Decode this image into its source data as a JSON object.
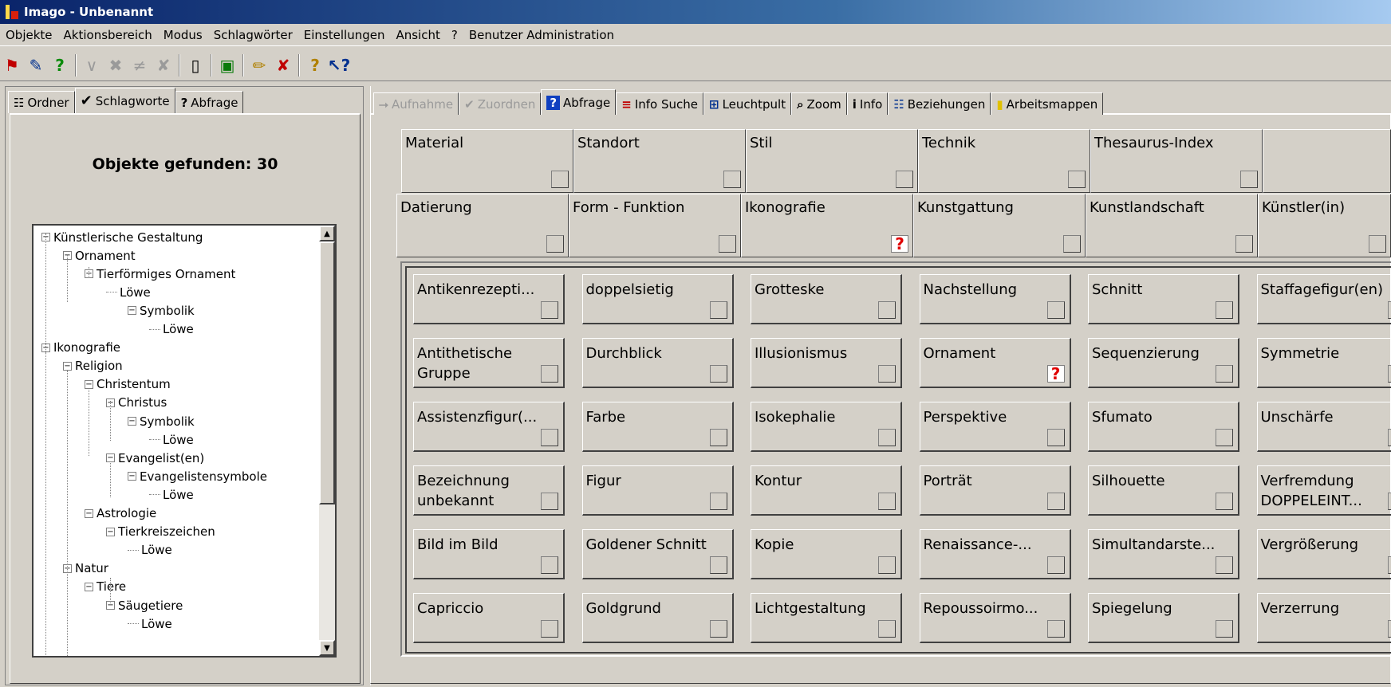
{
  "window": {
    "title": "Imago - Unbenannt"
  },
  "menu": [
    "Objekte",
    "Aktionsbereich",
    "Modus",
    "Schlagwörter",
    "Einstellungen",
    "Ansicht",
    "?",
    "Benutzer Administration"
  ],
  "toolbar": [
    "folders-icon",
    "edit-icon",
    "help-icon",
    "disabled-icon",
    "disabled-icon",
    "disabled-icon",
    "disabled-icon",
    "document-icon",
    "green-book-icon",
    "pencil-icon",
    "red-cross-icon",
    "help-icon",
    "what-is-icon"
  ],
  "left": {
    "tabs": [
      "Ordner",
      "Schlagworte",
      "Abfrage"
    ],
    "found_label": "Objekte gefunden: 30",
    "tree": [
      {
        "label": "Künstlerische Gestaltung",
        "lvl": 0,
        "exp": true
      },
      {
        "label": "Ornament",
        "lvl": 1,
        "exp": true
      },
      {
        "label": "Tierförmiges Ornament",
        "lvl": 2,
        "exp": true
      },
      {
        "label": "Löwe",
        "lvl": 3,
        "exp": false
      },
      {
        "label": "Symbolik",
        "lvl": 4,
        "exp": true
      },
      {
        "label": "Löwe",
        "lvl": 5,
        "exp": false
      },
      {
        "label": "Ikonografie",
        "lvl": 0,
        "exp": true
      },
      {
        "label": "Religion",
        "lvl": 1,
        "exp": true
      },
      {
        "label": "Christentum",
        "lvl": 2,
        "exp": true
      },
      {
        "label": "Christus",
        "lvl": 3,
        "exp": true
      },
      {
        "label": "Symbolik",
        "lvl": 4,
        "exp": true
      },
      {
        "label": "Löwe",
        "lvl": 5,
        "exp": false
      },
      {
        "label": "Evangelist(en)",
        "lvl": 3,
        "exp": true
      },
      {
        "label": "Evangelistensymbole",
        "lvl": 4,
        "exp": true
      },
      {
        "label": "Löwe",
        "lvl": 5,
        "exp": false
      },
      {
        "label": "Astrologie",
        "lvl": 2,
        "exp": true
      },
      {
        "label": "Tierkreiszeichen",
        "lvl": 3,
        "exp": true
      },
      {
        "label": "Löwe",
        "lvl": 4,
        "exp": false
      },
      {
        "label": "Natur",
        "lvl": 1,
        "exp": true
      },
      {
        "label": "Tiere",
        "lvl": 2,
        "exp": true
      },
      {
        "label": "Säugetiere",
        "lvl": 3,
        "exp": true
      },
      {
        "label": "Löwe",
        "lvl": 4,
        "exp": false
      }
    ]
  },
  "right": {
    "tabs": [
      {
        "label": "Aufnahme",
        "state": "disabled"
      },
      {
        "label": "Zuordnen",
        "state": "disabled"
      },
      {
        "label": "Abfrage",
        "state": "active"
      },
      {
        "label": "Info Suche",
        "state": "normal"
      },
      {
        "label": "Leuchtpult",
        "state": "normal"
      },
      {
        "label": "Zoom",
        "state": "normal"
      },
      {
        "label": "Info",
        "state": "normal"
      },
      {
        "label": "Beziehungen",
        "state": "normal"
      },
      {
        "label": "Arbeitsmappen",
        "state": "normal"
      }
    ],
    "fields_row1": [
      {
        "label": "Material",
        "q": false
      },
      {
        "label": "Standort",
        "q": false
      },
      {
        "label": "Stil",
        "q": false
      },
      {
        "label": "Technik",
        "q": false
      },
      {
        "label": "Thesaurus-Index",
        "q": false
      },
      {
        "label": "",
        "q": false
      }
    ],
    "fields_row2": [
      {
        "label": "Datierung",
        "q": false
      },
      {
        "label": "Form - Funktion",
        "q": false
      },
      {
        "label": "Ikonografie",
        "q": true
      },
      {
        "label": "Kunstgattung",
        "q": false
      },
      {
        "label": "Kunstlandschaft",
        "q": false
      },
      {
        "label": "Künstler(in)",
        "q": false
      }
    ],
    "keyword_columns": [
      [
        "Antikenrezepti...",
        "Antithetische Gruppe",
        "Assistenzfigur(...",
        "Bezeichnung unbekannt",
        "Bild im Bild",
        "Capriccio"
      ],
      [
        "doppelsietig",
        "Durchblick",
        "Farbe",
        "Figur",
        "Goldener Schnitt",
        "Goldgrund"
      ],
      [
        "Grotteske",
        "Illusionismus",
        "Isokephalie",
        "Kontur",
        "Kopie",
        "Lichtgestaltung"
      ],
      [
        "Nachstellung",
        "Ornament",
        "Perspektive",
        "Porträt",
        "Renaissance-...",
        "Repoussoirmo..."
      ],
      [
        "Schnitt",
        "Sequenzierung",
        "Sfumato",
        "Silhouette",
        "Simultandarste...",
        "Spiegelung"
      ],
      [
        "Staffagefigur(en)",
        "Symmetrie",
        "Unschärfe",
        "Verfremdung DOPPELEINT...",
        "Vergrößerung",
        "Verzerrung"
      ]
    ],
    "keyword_query_marks": [
      "Ornament"
    ]
  }
}
